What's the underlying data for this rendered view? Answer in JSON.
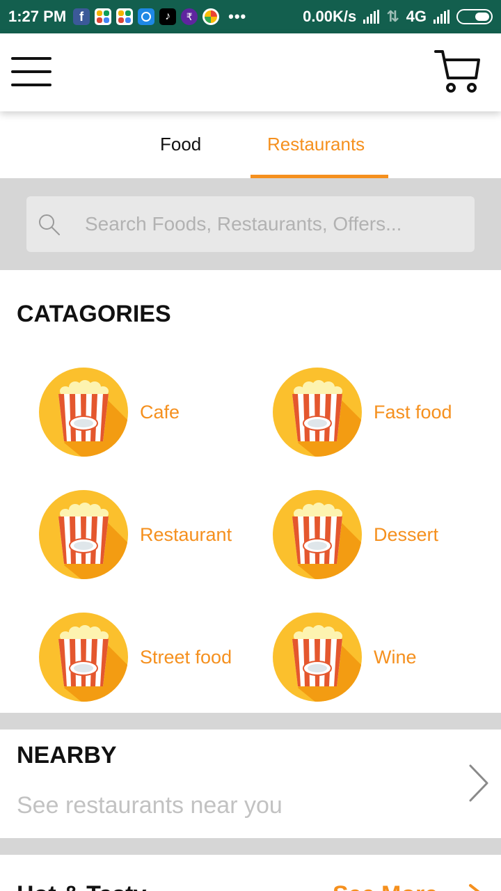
{
  "status_bar": {
    "time": "1:27 PM",
    "net_speed": "0.00K/s",
    "network": "4G",
    "overflow": "•••",
    "app_icons": [
      "facebook-icon",
      "app-grid-icon",
      "app-grid-icon",
      "share-icon",
      "tiktok-icon",
      "phonepe-icon",
      "photos-icon"
    ]
  },
  "header": {
    "menu_icon": "hamburger-menu-icon",
    "cart_icon": "shopping-cart-icon"
  },
  "tabs": [
    {
      "label": "Food",
      "active": false
    },
    {
      "label": "Restaurants",
      "active": true
    }
  ],
  "search": {
    "placeholder": "Search Foods, Restaurants, Offers...",
    "value": ""
  },
  "categories": {
    "title": "CATAGORIES",
    "items": [
      {
        "label": "Cafe",
        "icon": "popcorn-icon"
      },
      {
        "label": "Fast food",
        "icon": "popcorn-icon"
      },
      {
        "label": "Restaurant",
        "icon": "popcorn-icon"
      },
      {
        "label": "Dessert",
        "icon": "popcorn-icon"
      },
      {
        "label": "Street food",
        "icon": "popcorn-icon"
      },
      {
        "label": "Wine",
        "icon": "popcorn-icon"
      }
    ]
  },
  "nearby": {
    "title": "NEARBY",
    "subtitle": "See restaurants near you"
  },
  "hot": {
    "title": "Hot & Tasty",
    "see_more": "See More"
  },
  "colors": {
    "accent": "#f5901e",
    "status_bar": "#135f4e",
    "divider": "#d6d6d6"
  }
}
